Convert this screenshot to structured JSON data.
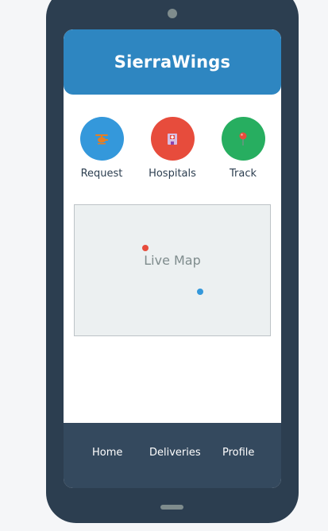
{
  "header": {
    "title": "SierraWings",
    "color": "#2e86c1"
  },
  "quick_actions": [
    {
      "label": "Request",
      "icon": "helicopter-icon",
      "color": "#3498db"
    },
    {
      "label": "Hospitals",
      "icon": "hospital-icon",
      "color": "#e74c3c"
    },
    {
      "label": "Track",
      "icon": "location-pin-icon",
      "color": "#27ae60"
    }
  ],
  "map": {
    "label": "Live Map",
    "markers": [
      {
        "name": "red-marker",
        "color": "#e74c3c"
      },
      {
        "name": "blue-marker",
        "color": "#3498db"
      }
    ]
  },
  "bottom_nav": {
    "items": [
      "Home",
      "Deliveries",
      "Profile"
    ],
    "color": "#34495e"
  }
}
